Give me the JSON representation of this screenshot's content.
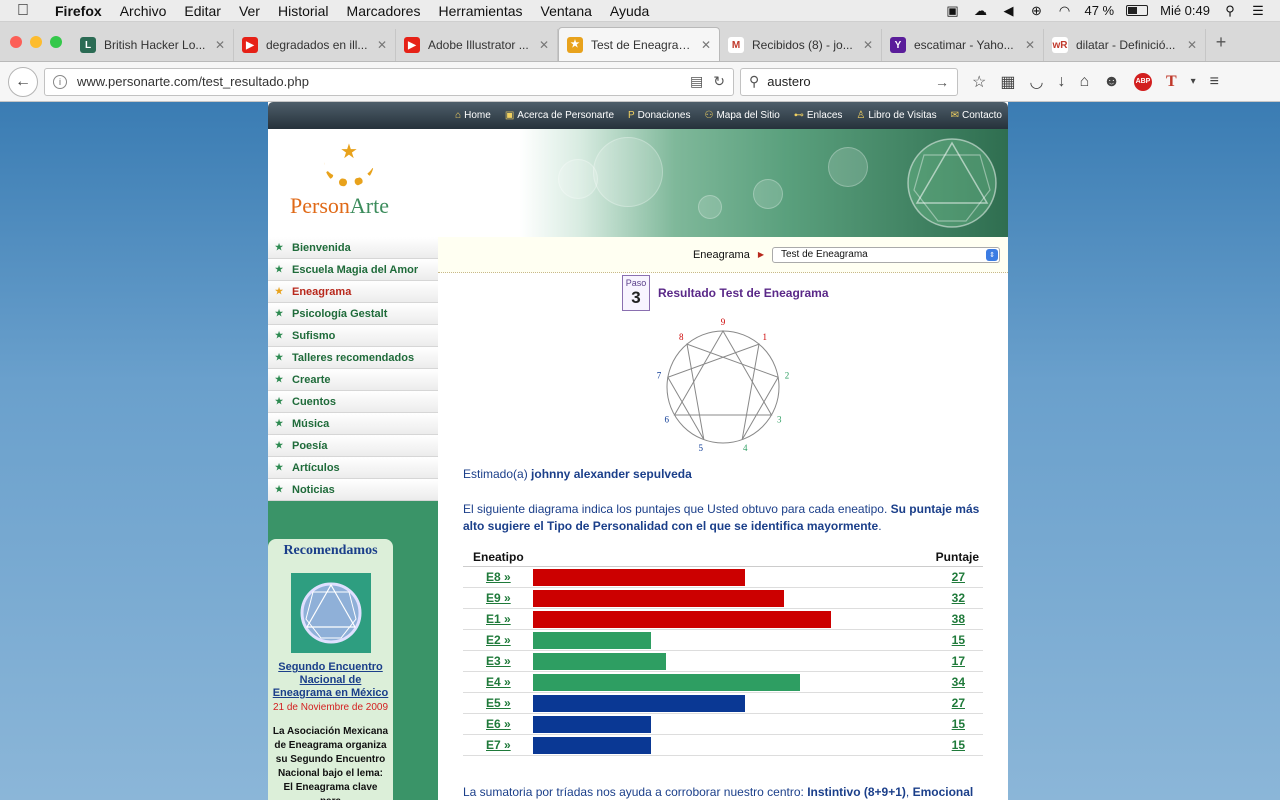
{
  "menubar": {
    "app": "Firefox",
    "items": [
      "Archivo",
      "Editar",
      "Ver",
      "Historial",
      "Marcadores",
      "Herramientas",
      "Ventana",
      "Ayuda"
    ],
    "battery": "47 %",
    "clock": "Mié 0:49"
  },
  "tabs": [
    {
      "title": "British Hacker Lo...",
      "color": "#2b6b54",
      "glyph": "L"
    },
    {
      "title": "degradados en ill...",
      "color": "#e62117",
      "glyph": "▶"
    },
    {
      "title": "Adobe Illustrator ...",
      "color": "#e62117",
      "glyph": "▶"
    },
    {
      "title": "Test de Eneagrama",
      "color": "#e8a21c",
      "glyph": "★",
      "active": true
    },
    {
      "title": "Recibidos (8) - jo...",
      "color": "#ffffff",
      "glyph": "M"
    },
    {
      "title": "escatimar - Yaho...",
      "color": "#5a1d9a",
      "glyph": "Y"
    },
    {
      "title": "dilatar - Definició...",
      "color": "#ffffff",
      "glyph": "wR"
    }
  ],
  "nav": {
    "url": "www.personarte.com/test_resultado.php",
    "search_value": "austero"
  },
  "site": {
    "topnav": [
      "Home",
      "Acerca de Personarte",
      "Donaciones",
      "Mapa del Sitio",
      "Enlaces",
      "Libro de Visitas",
      "Contacto"
    ],
    "logo_person": "Person",
    "logo_arte": "Arte",
    "sidebar": [
      "Bienvenida",
      "Escuela Magia del Amor",
      "Eneagrama",
      "Psicología Gestalt",
      "Sufismo",
      "Talleres recomendados",
      "Crearte",
      "Cuentos",
      "Música",
      "Poesía",
      "Artículos",
      "Noticias"
    ],
    "sidebar_active": "Eneagrama",
    "recommend": {
      "title": "Recomendamos",
      "link": "Segundo Encuentro Nacional de Eneagrama en México",
      "date": "21 de Noviembre de 2009",
      "body": "La Asociación Mexicana de Eneagrama organiza su Segundo Encuentro Nacional bajo el lema: El Eneagrama clave para"
    },
    "crumb_label": "Eneagrama",
    "select_value": "Test de Eneagrama",
    "step_word": "Paso",
    "step_num": "3",
    "step_title": "Resultado Test de Eneagrama",
    "greeting_prefix": "Estimado(a) ",
    "greeting_name": "johnny alexander sepulveda",
    "intro_plain": "El siguiente diagrama indica los puntajes que Usted obtuvo para cada eneatipo. ",
    "intro_bold": "Su puntaje más alto sugiere el Tipo de Personalidad con el que se identifica mayormente",
    "intro_end": ".",
    "table_head_left": "Eneatipo",
    "table_head_right": "Puntaje",
    "footer_plain": "La sumatoria por tríadas nos ayuda a corroborar nuestro centro: ",
    "footer_bold1": "Instintivo (8+9+1)",
    "footer_sep": ", ",
    "footer_bold2": "Emocional"
  },
  "enneagram_numbers": [
    "9",
    "1",
    "2",
    "3",
    "4",
    "5",
    "6",
    "7",
    "8"
  ],
  "chart_data": {
    "type": "bar",
    "categories": [
      "E8 »",
      "E9 »",
      "E1 »",
      "E2 »",
      "E3 »",
      "E4 »",
      "E5 »",
      "E6 »",
      "E7 »"
    ],
    "values": [
      27,
      32,
      38,
      15,
      17,
      34,
      27,
      15,
      15
    ],
    "colors": [
      "#cc0000",
      "#cc0000",
      "#cc0000",
      "#2e9e62",
      "#2e9e62",
      "#2e9e62",
      "#0a3894",
      "#0a3894",
      "#0a3894"
    ],
    "xlim": [
      0,
      51
    ],
    "xlabel": "Puntaje",
    "ylabel": "Eneatipo"
  }
}
